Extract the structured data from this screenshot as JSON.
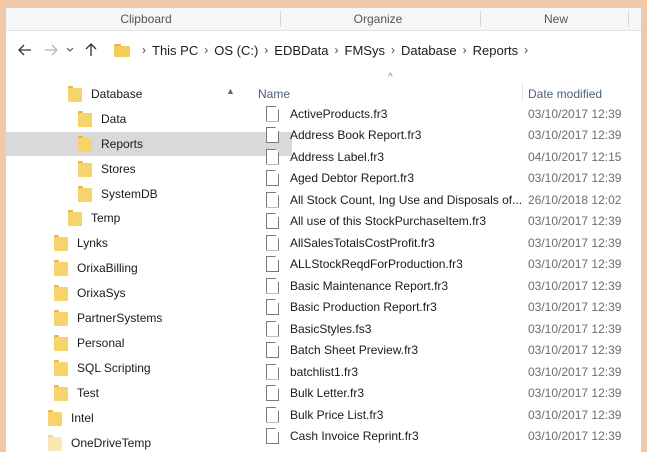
{
  "ribbon": {
    "groups": [
      "Clipboard",
      "Organize",
      "New"
    ]
  },
  "nav": {
    "back_icon": "arrow-left-icon",
    "forward_icon": "arrow-right-icon",
    "recent_icon": "chevron-down-icon",
    "up_icon": "arrow-up-icon"
  },
  "breadcrumb": [
    "This PC",
    "OS (C:)",
    "EDBData",
    "FMSys",
    "Database",
    "Reports"
  ],
  "navpane": {
    "items": [
      {
        "label": "Database"
      },
      {
        "label": "Data"
      },
      {
        "label": "Reports"
      },
      {
        "label": "Stores"
      },
      {
        "label": "SystemDB"
      },
      {
        "label": "Temp"
      },
      {
        "label": "Lynks"
      },
      {
        "label": "OrixaBilling"
      },
      {
        "label": "OrixaSys"
      },
      {
        "label": "PartnerSystems"
      },
      {
        "label": "Personal"
      },
      {
        "label": "SQL Scripting"
      },
      {
        "label": "Test"
      },
      {
        "label": "Intel"
      },
      {
        "label": "OneDriveTemp"
      }
    ]
  },
  "filelist": {
    "columns": {
      "name": "Name",
      "date": "Date modified"
    },
    "rows": [
      {
        "name": "ActiveProducts.fr3",
        "date": "03/10/2017 12:39"
      },
      {
        "name": "Address Book Report.fr3",
        "date": "03/10/2017 12:39"
      },
      {
        "name": "Address Label.fr3",
        "date": "04/10/2017 12:15"
      },
      {
        "name": "Aged Debtor Report.fr3",
        "date": "03/10/2017 12:39"
      },
      {
        "name": "All Stock Count, Ing Use and Disposals of...",
        "date": "26/10/2018 12:02"
      },
      {
        "name": "All use of this StockPurchaseItem.fr3",
        "date": "03/10/2017 12:39"
      },
      {
        "name": "AllSalesTotalsCostProfit.fr3",
        "date": "03/10/2017 12:39"
      },
      {
        "name": "ALLStockReqdForProduction.fr3",
        "date": "03/10/2017 12:39"
      },
      {
        "name": "Basic Maintenance Report.fr3",
        "date": "03/10/2017 12:39"
      },
      {
        "name": "Basic Production Report.fr3",
        "date": "03/10/2017 12:39"
      },
      {
        "name": "BasicStyles.fs3",
        "date": "03/10/2017 12:39"
      },
      {
        "name": "Batch Sheet Preview.fr3",
        "date": "03/10/2017 12:39"
      },
      {
        "name": "batchlist1.fr3",
        "date": "03/10/2017 12:39"
      },
      {
        "name": "Bulk Letter.fr3",
        "date": "03/10/2017 12:39"
      },
      {
        "name": "Bulk Price List.fr3",
        "date": "03/10/2017 12:39"
      },
      {
        "name": "Cash Invoice Reprint.fr3",
        "date": "03/10/2017 12:39"
      }
    ]
  }
}
